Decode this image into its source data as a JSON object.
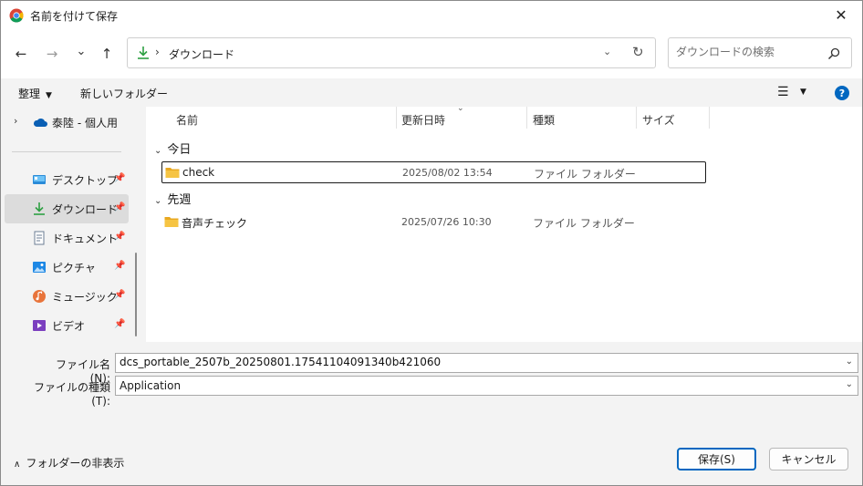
{
  "window": {
    "title": "名前を付けて保存",
    "close_glyph": "✕"
  },
  "nav": {
    "back_glyph": "←",
    "forward_glyph": "→",
    "recent_glyph": "⌄",
    "up_glyph": "↑",
    "address_sep": "›",
    "address_path": "ダウンロード",
    "address_dd_glyph": "⌄",
    "refresh_glyph": "↻",
    "search_placeholder": "ダウンロードの検索"
  },
  "toolbar": {
    "organize_label": "整理",
    "organize_caret": "▼",
    "new_folder_label": "新しいフォルダー",
    "view_glyph": "☰",
    "view_caret": "▼",
    "help_glyph": "?"
  },
  "sidebar": {
    "onedrive": {
      "chevron": "›",
      "label": "泰陸 - 個人用"
    },
    "pin_glyph": "📌",
    "items": [
      {
        "label": "デスクトップ",
        "icon": "desktop-icon"
      },
      {
        "label": "ダウンロード",
        "icon": "download-icon",
        "selected": true
      },
      {
        "label": "ドキュメント",
        "icon": "document-icon"
      },
      {
        "label": "ピクチャ",
        "icon": "pictures-icon"
      },
      {
        "label": "ミュージック",
        "icon": "music-icon"
      },
      {
        "label": "ビデオ",
        "icon": "video-icon"
      }
    ]
  },
  "filelist": {
    "columns": {
      "name": "名前",
      "modified": "更新日時",
      "type": "種類",
      "size": "サイズ"
    },
    "sort_glyph": "⌄",
    "group_chevron": "⌄",
    "groups": [
      {
        "title": "今日",
        "rows": [
          {
            "name": "check",
            "modified": "2025/08/02 13:54",
            "type": "ファイル フォルダー"
          }
        ]
      },
      {
        "title": "先週",
        "rows": [
          {
            "name": "音声チェック",
            "modified": "2025/07/26 10:30",
            "type": "ファイル フォルダー"
          }
        ]
      }
    ]
  },
  "form": {
    "filename_label": "ファイル名(N):",
    "filename_value": "dcs_portable_2507b_20250801.17541104091340b421060",
    "filetype_label": "ファイルの種類(T):",
    "filetype_value": "Application",
    "dd_glyph": "⌄"
  },
  "footer": {
    "hide_folders_caret": "∧",
    "hide_folders_label": "フォルダーの非表示",
    "save_label": "保存(S)",
    "cancel_label": "キャンセル"
  },
  "colors": {
    "accent": "#0067c0",
    "folder": "#f6c443",
    "download_green": "#2ea043"
  }
}
